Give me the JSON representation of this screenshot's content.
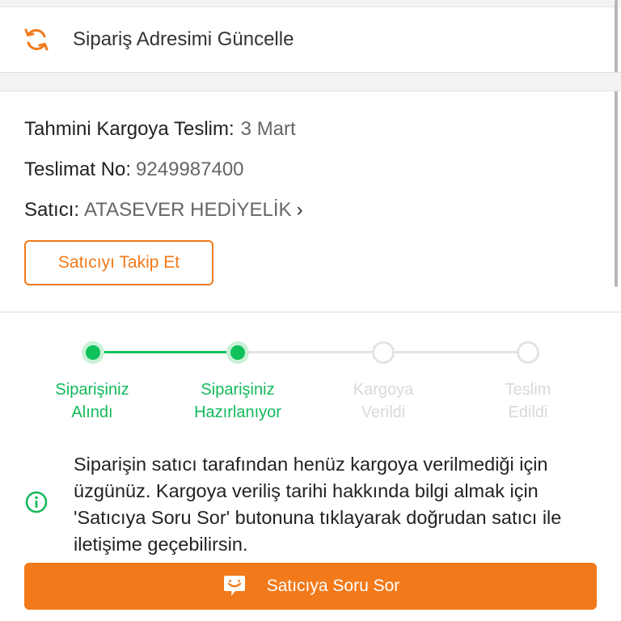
{
  "address_update": {
    "label": "Sipariş Adresimi Güncelle",
    "icon": "refresh-icon"
  },
  "info": {
    "estimated_label": "Tahmini Kargoya Teslim:",
    "estimated_value": "3 Mart",
    "delivery_no_label": "Teslimat No:",
    "delivery_no_value": "9249987400",
    "seller_label": "Satıcı:",
    "seller_value": "ATASEVER HEDİYELİK",
    "seller_chevron": "›"
  },
  "follow_button": {
    "label": "Satıcıyı Takip Et"
  },
  "progress": {
    "steps": [
      {
        "line1": "Siparişiniz",
        "line2": "Alındı",
        "status": "done"
      },
      {
        "line1": "Siparişiniz",
        "line2": "Hazırlanıyor",
        "status": "done"
      },
      {
        "line1": "Kargoya",
        "line2": "Verildi",
        "status": "pending"
      },
      {
        "line1": "Teslim",
        "line2": "Edildi",
        "status": "pending"
      }
    ]
  },
  "notice": {
    "icon": "info-icon",
    "text": "Siparişin satıcı tarafından henüz kargoya verilmediği için üzgünüz. Kargoya veriliş tarihi hakkında bilgi almak için 'Satıcıya Soru Sor' butonuna tıklayarak doğrudan satıcı ile iletişime geçebilirsin."
  },
  "ask_button": {
    "label": "Satıcıya Soru Sor",
    "icon": "chat-bubble-icon"
  },
  "colors": {
    "accent": "#f27a1a",
    "success": "#12b95a",
    "pending": "#e3e3e3"
  }
}
